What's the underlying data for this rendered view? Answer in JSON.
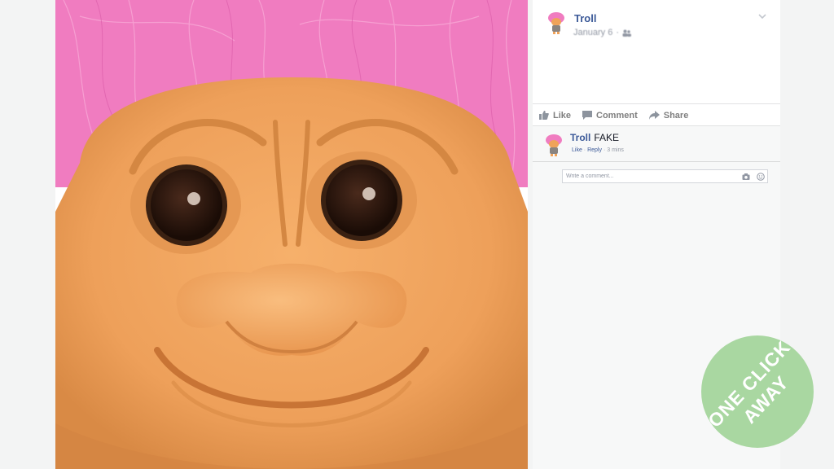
{
  "post": {
    "author": "Troll",
    "meta_date": "January 6",
    "meta_separator": "·",
    "audience_icon": "friends-icon",
    "options_icon": "chevron-down-icon"
  },
  "actions": {
    "like": "Like",
    "comment": "Comment",
    "share": "Share"
  },
  "comment": {
    "author": "Troll",
    "text": "FAKE",
    "like_link": "Like",
    "reply_link": "Reply",
    "separator": "·",
    "time": "3 mins"
  },
  "composer": {
    "placeholder": "Write a comment...",
    "camera_icon": "camera-icon",
    "emoji_icon": "emoji-icon"
  },
  "badge": {
    "line1": "ONE CLICK",
    "line2": "AWAY",
    "color": "#a9d7a1"
  },
  "colors": {
    "link_blue": "#3b5998",
    "troll_hair": "#f07cc0",
    "troll_skin": "#f0a35a"
  }
}
